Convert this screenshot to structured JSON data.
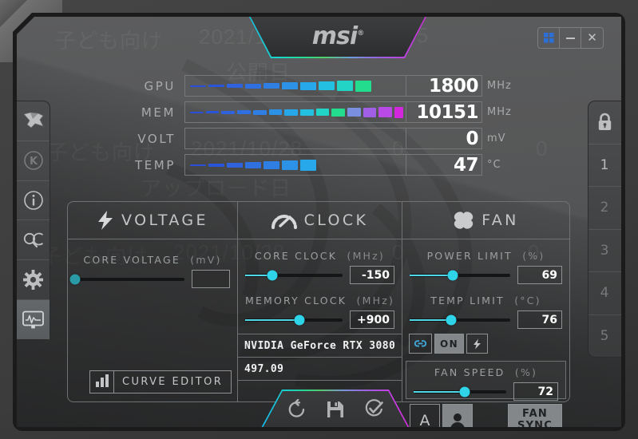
{
  "app": {
    "brand": "msi",
    "brand_tm": "®"
  },
  "window_controls": {
    "windows_label": "windows-logo",
    "minimize_label": "—",
    "close_label": "✕"
  },
  "monitor": {
    "rows": [
      {
        "label": "GPU",
        "value": "1800",
        "unit": "MHz",
        "fill_segments": 10,
        "total_segments": 24
      },
      {
        "label": "MEM",
        "value": "10151",
        "unit": "MHz",
        "fill_segments": 14,
        "total_segments": 24
      },
      {
        "label": "VOLT",
        "value": "0",
        "unit": "mV",
        "fill_segments": 0,
        "total_segments": 24
      },
      {
        "label": "TEMP",
        "value": "47",
        "unit": "°C",
        "fill_segments": 7,
        "total_segments": 24
      }
    ]
  },
  "sidebar_left": {
    "items": [
      {
        "name": "msi-dragon-icon",
        "icon": "dragon",
        "dim": false
      },
      {
        "name": "kombustor-icon",
        "icon": "k-circle",
        "dim": true
      },
      {
        "name": "info-icon",
        "icon": "info",
        "dim": false
      },
      {
        "name": "oc-scanner-icon",
        "icon": "oc",
        "dim": false
      },
      {
        "name": "settings-icon",
        "icon": "gear",
        "dim": false
      },
      {
        "name": "monitoring-icon",
        "icon": "monitor",
        "dim": false
      }
    ]
  },
  "sidebar_right": {
    "lock": {
      "name": "lock-icon",
      "locked": true
    },
    "profiles": [
      {
        "label": "1",
        "active": true
      },
      {
        "label": "2",
        "active": false
      },
      {
        "label": "3",
        "active": false
      },
      {
        "label": "4",
        "active": false
      },
      {
        "label": "5",
        "active": false
      }
    ]
  },
  "voltage_panel": {
    "title": "VOLTAGE",
    "icon": "lightning-bolt-icon",
    "core_voltage": {
      "label": "CORE VOLTAGE",
      "unit": "(mV)",
      "value": "",
      "percent": 0
    },
    "curve_editor": {
      "label": "CURVE EDITOR",
      "icon": "bar-chart-icon"
    }
  },
  "clock_panel": {
    "title": "CLOCK",
    "icon": "speedometer-icon",
    "core_clock": {
      "label": "CORE CLOCK",
      "unit": "(MHz)",
      "value": "-150",
      "percent": 28
    },
    "memory_clock": {
      "label": "MEMORY CLOCK",
      "unit": "(MHz)",
      "value": "+900",
      "percent": 56
    },
    "gpu_name": "NVIDIA GeForce RTX 3080",
    "driver_version": "497.09"
  },
  "fan_panel": {
    "title": "FAN",
    "icon": "fan-icon",
    "power_limit": {
      "label": "POWER LIMIT",
      "unit": "(%)",
      "value": "69",
      "percent": 43
    },
    "temp_limit": {
      "label": "TEMP LIMIT",
      "unit": "(°C)",
      "value": "76",
      "percent": 41
    },
    "toggles": [
      {
        "name": "link-toggle",
        "icon": "link-icon",
        "label": "",
        "on": false
      },
      {
        "name": "on-toggle",
        "icon": "",
        "label": "ON",
        "on": true
      },
      {
        "name": "lightning-toggle",
        "icon": "lightning-icon",
        "label": "",
        "on": false
      }
    ],
    "fan_speed": {
      "label": "FAN SPEED",
      "unit": "(%)",
      "value": "72",
      "percent": 55
    },
    "fan_auto_button": {
      "name": "fan-auto-button",
      "label": "A",
      "selected": false
    },
    "fan_manual_button": {
      "name": "fan-manual-button",
      "icon": "user-icon",
      "selected": true
    },
    "fan_sync_button": {
      "line1": "FAN",
      "line2": "SYNC",
      "selected": true
    }
  },
  "actions": [
    {
      "name": "reset-button",
      "icon": "reset-icon"
    },
    {
      "name": "save-button",
      "icon": "save-icon"
    },
    {
      "name": "apply-button",
      "icon": "apply-check-icon"
    }
  ],
  "background_bleed": [
    "子ども向け",
    "2021/10/28",
    "公開日",
    "485",
    "子ども向け",
    "2021/10/28",
    "アップロード日",
    "子ども向け",
    "2021/10/28",
    "0",
    "0",
    "0",
    "0"
  ],
  "colors": {
    "accent_cyan": "#2fd4e8",
    "rgb_gradient_start": "#16b6e8",
    "rgb_gradient_end": "#cf2fd8",
    "value_white": "#ffffff",
    "label_gray": "#9c9fa0",
    "panel_border": "#6f7274"
  },
  "bar_palette": [
    "#2b4fd8",
    "#2b55d8",
    "#2f62dc",
    "#2f6fe0",
    "#2e7ee4",
    "#2b92e8",
    "#27a8ea",
    "#24c0e2",
    "#22d4c6",
    "#23dc8e",
    "#7b8fe0",
    "#a05fe4",
    "#b94ae6",
    "#d227dc",
    "#e818d8",
    "#ee12d4",
    "#f20fd0",
    "#f50ccc",
    "#f70ac8",
    "#f908c4",
    "#fb06c0",
    "#fc04bc",
    "#fd02b8",
    "#fe00b4"
  ]
}
